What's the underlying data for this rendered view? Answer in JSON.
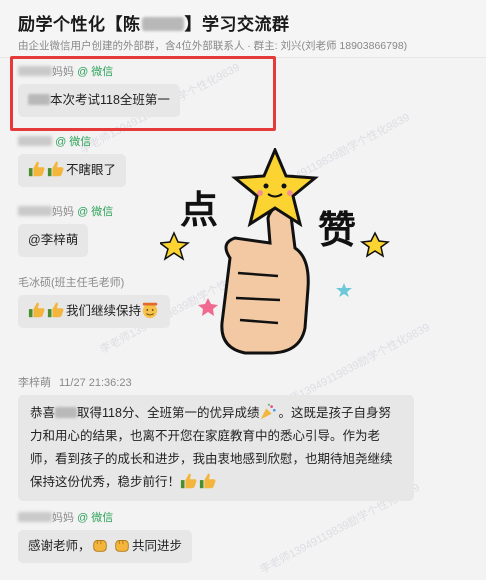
{
  "header": {
    "title_prefix": "励学个性化【陈",
    "title_suffix": "】学习交流群",
    "subtitle": "由企业微信用户创建的外部群，含4位外部联系人 · 群主: 刘兴(刘老师 18903866798)"
  },
  "messages": [
    {
      "sender_suffix": "妈妈",
      "tag": "@ 微信",
      "text": "本次考试118全班第一"
    },
    {
      "sender_suffix": "",
      "tag": "@ 微信",
      "text": "不瞎眼了"
    },
    {
      "sender_suffix": "妈妈",
      "tag": "@ 微信",
      "text": "@李梓萌"
    },
    {
      "sender": "毛冰硕(班主任毛老师)",
      "text": "我们继续保持"
    },
    {
      "sender": "李梓萌",
      "time": "11/27 21:36:23",
      "text_a": "恭喜",
      "text_b": "取得118分、全班第一的优异成绩",
      "text_c": "。这既是孩子自身努力和用心的结果，也离不开您在家庭教育中的悉心引导。作为老师，看到孩子的成长和进步，我由衷地感到欣慰，也期待旭尧继续保持这份优秀，稳步前行！"
    },
    {
      "sender_suffix": "妈妈",
      "tag": "@ 微信",
      "text_a": "感谢老师，",
      "text_b": "共同进步"
    }
  ],
  "sticker": {
    "text_left": "点",
    "text_right": "赞"
  },
  "watermark": "李老师13949119839励学个性化9839",
  "colors": {
    "accent_green": "#2fa35b",
    "highlight_red": "#e63a3a",
    "bubble": "#e7e7e7"
  }
}
